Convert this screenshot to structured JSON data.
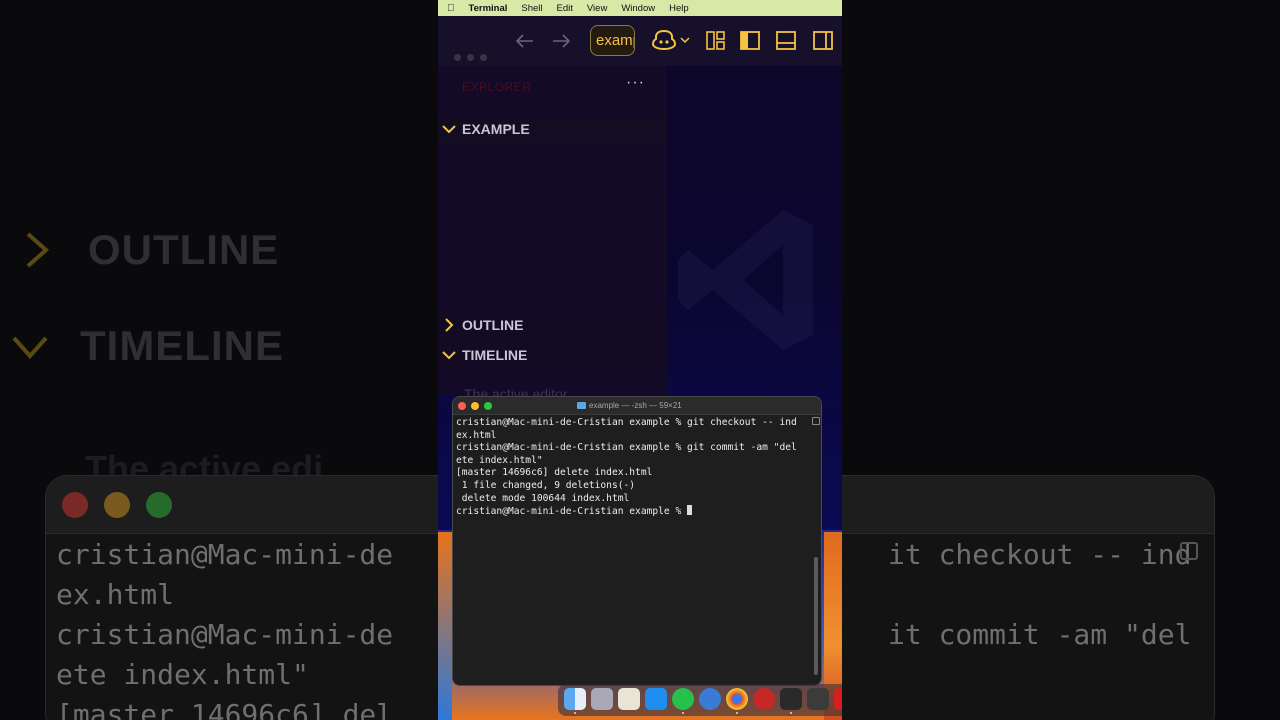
{
  "background": {
    "outline_label": "OUTLINE",
    "timeline_label": "TIMELINE",
    "active_editor_text": "The active edi",
    "terminal_lines_left": [
      "cristian@Mac-mini-de",
      "ex.html",
      "cristian@Mac-mini-de",
      "ete index.html\"",
      "[master 14696c6] del"
    ],
    "terminal_lines_right": [
      "it checkout -- ind",
      "",
      "it commit -am \"del"
    ]
  },
  "menubar": {
    "app_name": "Terminal",
    "items": [
      "Shell",
      "Edit",
      "View",
      "Window",
      "Help"
    ]
  },
  "toolbar": {
    "search_value": "example"
  },
  "sidebar": {
    "explorer_title": "EXPLORER",
    "more": "···",
    "sections": {
      "example": "EXAMPLE",
      "outline": "OUTLINE",
      "timeline": "TIMELINE"
    },
    "timeline_message": "The active editor"
  },
  "terminal": {
    "title": "example — -zsh — 59×21",
    "lines": [
      "cristian@Mac-mini-de-Cristian example % git checkout -- ind",
      "ex.html",
      "cristian@Mac-mini-de-Cristian example % git commit -am \"del",
      "ete index.html\"",
      "[master 14696c6] delete index.html",
      " 1 file changed, 9 deletions(-)",
      " delete mode 100644 index.html"
    ],
    "prompt": "cristian@Mac-mini-de-Cristian example % "
  },
  "dock": {
    "apps": [
      "finder",
      "launchpad",
      "notes",
      "app-store",
      "whatsapp",
      "safari",
      "chrome",
      "opera",
      "sublime",
      "calculator",
      "acrobat"
    ]
  },
  "colors": {
    "menubar_bg": "#d8e8a6",
    "accent_yellow": "#f5c242",
    "terminal_bg": "#1e1e1e",
    "close": "#ff5f57",
    "minimize": "#febc2e",
    "maximize": "#28c840"
  }
}
